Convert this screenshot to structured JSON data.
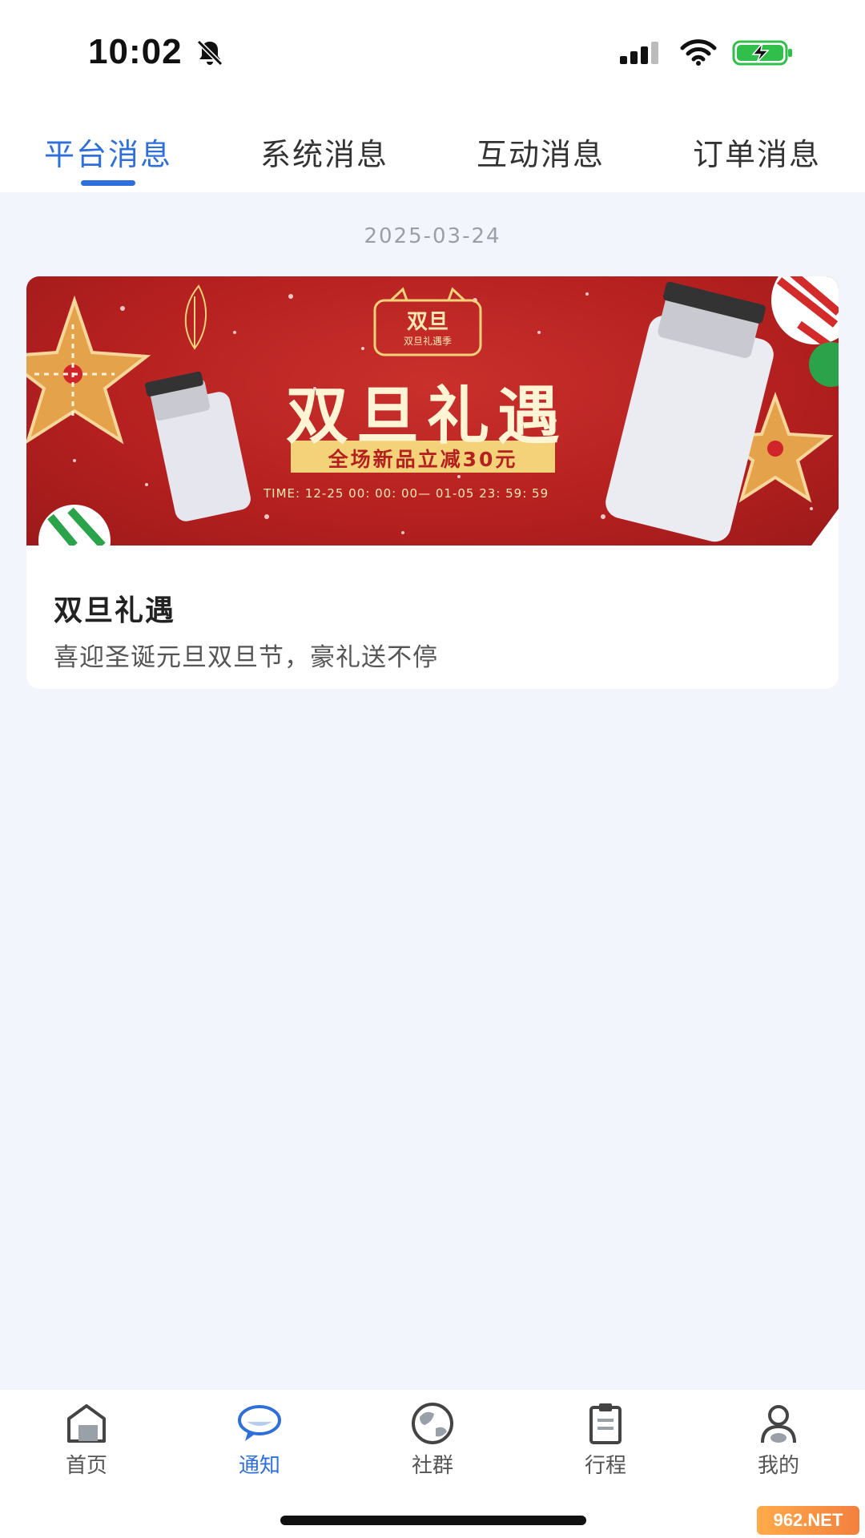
{
  "status_bar": {
    "time": "10:02",
    "icons": [
      "bell-off-icon",
      "signal-icon",
      "wifi-icon",
      "battery-charging-icon"
    ]
  },
  "tabs": [
    {
      "label": "平台消息",
      "active": true
    },
    {
      "label": "系统消息",
      "active": false
    },
    {
      "label": "互动消息",
      "active": false
    },
    {
      "label": "订单消息",
      "active": false
    }
  ],
  "feed": {
    "date": "2025-03-24",
    "card": {
      "banner": {
        "logo_text": "双旦",
        "logo_subtext": "双旦礼遇季",
        "headline": "双旦礼遇",
        "promo": "全场新品立减30元",
        "time_text": "TIME: 12-25 00: 00: 00— 01-05 23: 59: 59"
      },
      "title": "双旦礼遇",
      "description": "喜迎圣诞元旦双旦节，豪礼送不停"
    }
  },
  "bottom_nav": [
    {
      "label": "首页",
      "icon": "home-icon",
      "active": false
    },
    {
      "label": "通知",
      "icon": "chat-bubble-icon",
      "active": true
    },
    {
      "label": "社群",
      "icon": "globe-icon",
      "active": false
    },
    {
      "label": "行程",
      "icon": "clipboard-icon",
      "active": false
    },
    {
      "label": "我的",
      "icon": "person-icon",
      "active": false
    }
  ],
  "watermark": "962.NET",
  "colors": {
    "accent": "#2f6fdb",
    "background": "#f2f5fb",
    "banner_red": "#b4201f",
    "gold": "#f3d27a"
  }
}
